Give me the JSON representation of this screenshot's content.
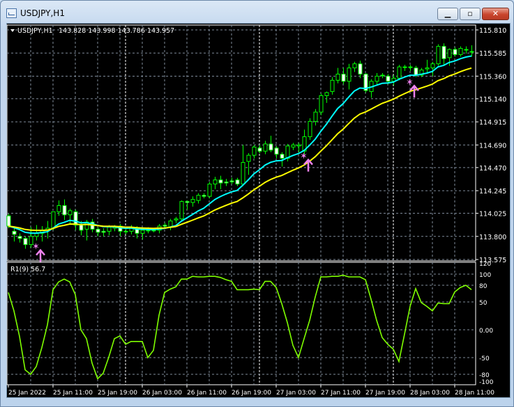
{
  "window": {
    "title": "USDJPY,H1",
    "buttons": {
      "minimize": "▁",
      "maximize": "▫",
      "close": "✕"
    }
  },
  "chart_header": {
    "symbol": "USDJPY,H1",
    "ohlc": "143.828 143.998 143.786 143.957"
  },
  "colors": {
    "background": "#000000",
    "grid": "#7f8b9a",
    "bull_candle": "#00ff00",
    "bear_body": "#ffffff",
    "ma_fast": "#00ffff",
    "ma_slow": "#ffff00",
    "indicator_line": "#7fff00",
    "signal": "#ee82ee",
    "axis_text": "#ffffff"
  },
  "chart_data": [
    {
      "type": "candlestick",
      "symbol": "USDJPY",
      "timeframe": "H1",
      "ylim": [
        113.575,
        115.81
      ],
      "grid": true,
      "y_ticks": [
        "115.810",
        "115.585",
        "115.360",
        "115.140",
        "114.915",
        "114.690",
        "114.470",
        "114.245",
        "114.025",
        "113.800",
        "113.575"
      ],
      "x_ticks": [
        "25 Jan 2022",
        "25 Jan 11:00",
        "25 Jan 19:00",
        "26 Jan 03:00",
        "26 Jan 11:00",
        "26 Jan 19:00",
        "27 Jan 03:00",
        "27 Jan 11:00",
        "27 Jan 19:00",
        "28 Jan 03:00",
        "28 Jan 11:00"
      ],
      "ohlc": [
        [
          114.0,
          114.02,
          113.88,
          113.9
        ],
        [
          113.85,
          113.88,
          113.75,
          113.82
        ],
        [
          113.8,
          113.83,
          113.74,
          113.78
        ],
        [
          113.78,
          113.8,
          113.68,
          113.72
        ],
        [
          113.72,
          113.89,
          113.69,
          113.8
        ],
        [
          113.8,
          113.91,
          113.76,
          113.83
        ],
        [
          113.83,
          113.9,
          113.75,
          113.86
        ],
        [
          113.86,
          113.95,
          113.78,
          113.88
        ],
        [
          113.88,
          114.04,
          113.86,
          114.04
        ],
        [
          114.04,
          114.15,
          114.0,
          114.1
        ],
        [
          114.1,
          114.16,
          113.96,
          114.01
        ],
        [
          114.01,
          114.07,
          113.92,
          114.05
        ],
        [
          114.04,
          114.06,
          113.86,
          113.91
        ],
        [
          113.91,
          113.95,
          113.81,
          113.86
        ],
        [
          113.87,
          113.96,
          113.76,
          113.94
        ],
        [
          113.94,
          113.97,
          113.84,
          113.87
        ],
        [
          113.87,
          113.89,
          113.8,
          113.84
        ],
        [
          113.85,
          113.88,
          113.8,
          113.84
        ],
        [
          113.85,
          113.91,
          113.81,
          113.89
        ],
        [
          113.88,
          113.91,
          113.85,
          113.89
        ],
        [
          113.9,
          113.92,
          113.8,
          113.85
        ],
        [
          113.85,
          113.88,
          113.82,
          113.85
        ],
        [
          113.85,
          113.91,
          113.82,
          113.89
        ],
        [
          113.88,
          113.9,
          113.78,
          113.83
        ],
        [
          113.83,
          113.88,
          113.77,
          113.86
        ],
        [
          113.86,
          113.89,
          113.83,
          113.86
        ],
        [
          113.86,
          113.88,
          113.84,
          113.86
        ],
        [
          113.86,
          113.92,
          113.83,
          113.9
        ],
        [
          113.91,
          113.93,
          113.88,
          113.9
        ],
        [
          113.89,
          113.97,
          113.86,
          113.95
        ],
        [
          113.96,
          113.99,
          113.93,
          113.97
        ],
        [
          113.97,
          114.15,
          113.95,
          114.14
        ],
        [
          114.14,
          114.15,
          114.06,
          114.13
        ],
        [
          114.13,
          114.19,
          114.09,
          114.16
        ],
        [
          114.15,
          114.22,
          114.12,
          114.2
        ],
        [
          114.2,
          114.22,
          114.17,
          114.19
        ],
        [
          114.19,
          114.33,
          114.17,
          114.31
        ],
        [
          114.31,
          114.38,
          114.26,
          114.35
        ],
        [
          114.35,
          114.39,
          114.26,
          114.32
        ],
        [
          114.33,
          114.36,
          114.29,
          114.32
        ],
        [
          114.34,
          114.37,
          114.31,
          114.33
        ],
        [
          114.35,
          114.37,
          114.29,
          114.31
        ],
        [
          114.31,
          114.69,
          114.29,
          114.52
        ],
        [
          114.53,
          114.61,
          114.4,
          114.59
        ],
        [
          114.59,
          114.69,
          114.56,
          114.67
        ],
        [
          114.66,
          114.69,
          114.61,
          114.63
        ],
        [
          114.63,
          114.73,
          114.6,
          114.7
        ],
        [
          114.7,
          114.78,
          114.62,
          114.64
        ],
        [
          114.66,
          114.68,
          114.56,
          114.6
        ],
        [
          114.6,
          114.62,
          114.48,
          114.56
        ],
        [
          114.56,
          114.7,
          114.53,
          114.68
        ],
        [
          114.67,
          114.71,
          114.64,
          114.69
        ],
        [
          114.68,
          114.71,
          114.62,
          114.69
        ],
        [
          114.63,
          114.84,
          114.6,
          114.77
        ],
        [
          114.77,
          114.95,
          114.74,
          114.92
        ],
        [
          114.92,
          115.04,
          114.88,
          115.01
        ],
        [
          115.01,
          115.19,
          114.98,
          115.17
        ],
        [
          115.17,
          115.21,
          115.1,
          115.2
        ],
        [
          115.21,
          115.35,
          115.18,
          115.32
        ],
        [
          115.32,
          115.44,
          115.29,
          115.38
        ],
        [
          115.38,
          115.44,
          115.28,
          115.31
        ],
        [
          115.31,
          115.48,
          115.23,
          115.44
        ],
        [
          115.44,
          115.5,
          115.4,
          115.48
        ],
        [
          115.48,
          115.51,
          115.34,
          115.38
        ],
        [
          115.38,
          115.39,
          115.2,
          115.22
        ],
        [
          115.21,
          115.33,
          115.15,
          115.31
        ],
        [
          115.31,
          115.39,
          115.28,
          115.36
        ],
        [
          115.37,
          115.39,
          115.34,
          115.37
        ],
        [
          115.36,
          115.38,
          115.28,
          115.31
        ],
        [
          115.31,
          115.37,
          115.27,
          115.34
        ],
        [
          115.34,
          115.47,
          115.32,
          115.45
        ],
        [
          115.45,
          115.47,
          115.41,
          115.45
        ],
        [
          115.45,
          115.47,
          115.41,
          115.45
        ],
        [
          115.44,
          115.46,
          115.35,
          115.37
        ],
        [
          115.37,
          115.44,
          115.35,
          115.42
        ],
        [
          115.43,
          115.52,
          115.39,
          115.44
        ],
        [
          115.44,
          115.5,
          115.36,
          115.48
        ],
        [
          115.48,
          115.67,
          115.46,
          115.65
        ],
        [
          115.65,
          115.68,
          115.47,
          115.53
        ],
        [
          115.54,
          115.63,
          115.46,
          115.62
        ],
        [
          115.62,
          115.64,
          115.55,
          115.57
        ],
        [
          115.57,
          115.65,
          115.55,
          115.63
        ],
        [
          115.62,
          115.65,
          115.58,
          115.62
        ],
        [
          115.6,
          115.66,
          115.55,
          115.6
        ]
      ],
      "series": [
        {
          "name": "",
          "type": "line",
          "color": "#00ffff"
        },
        {
          "name": "",
          "type": "line",
          "color": "#ffff00"
        }
      ],
      "signals": [
        {
          "index": 5,
          "price": 113.7,
          "type": "buy-arrow"
        },
        {
          "index": 53,
          "price": 114.58,
          "type": "buy-arrow"
        },
        {
          "index": 72,
          "price": 115.3,
          "type": "buy-arrow"
        }
      ]
    },
    {
      "type": "line",
      "label": "R1(9) 56.7",
      "ylim": [
        -100,
        120
      ],
      "grid": true,
      "y_ticks": [
        "120",
        "100",
        "80",
        "50",
        "0.00",
        "-50",
        "-80",
        "-100"
      ],
      "y_tick_values": [
        120,
        100,
        80,
        50,
        0,
        -50,
        -80,
        -100
      ],
      "values": [
        67,
        34,
        -12,
        -72,
        -80,
        -66,
        -32,
        9,
        72,
        86,
        91,
        86,
        63,
        0,
        -16,
        -60,
        -88,
        -78,
        -49,
        -16,
        -11,
        -26,
        -21,
        -21,
        -21,
        -50,
        -37,
        26,
        67,
        73,
        77,
        91,
        91,
        96,
        95,
        95,
        96,
        96,
        94,
        90,
        87,
        72,
        72,
        72,
        73,
        72,
        87,
        87,
        76,
        47,
        13,
        -28,
        -50,
        -16,
        17,
        59,
        95,
        95,
        96,
        96,
        98,
        95,
        95,
        95,
        90,
        55,
        17,
        -14,
        -26,
        -35,
        -57,
        -8,
        42,
        74,
        49,
        42,
        34,
        48,
        47,
        47,
        68,
        76,
        80,
        72
      ]
    }
  ]
}
